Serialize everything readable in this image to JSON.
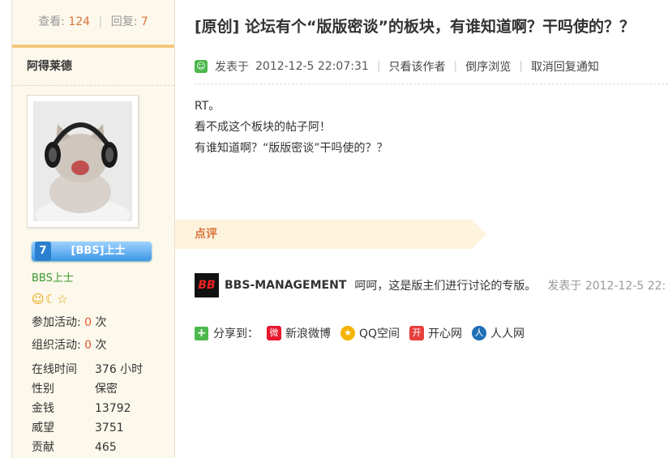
{
  "stats": {
    "views_label": "查看:",
    "views": "124",
    "replies_label": "回复:",
    "replies": "7"
  },
  "author": {
    "name": "阿得莱德",
    "badge_level": "7",
    "badge_title": "[BBS]上士",
    "group": "BBS上士",
    "activity_join_label": "参加活动:",
    "activity_join": "0",
    "activity_org_label": "组织活动:",
    "activity_org": "0",
    "times_unit": "次",
    "info": [
      {
        "k": "在线时间",
        "v": "376 小时"
      },
      {
        "k": "性别",
        "v": "保密"
      },
      {
        "k": "金钱",
        "v": "13792"
      },
      {
        "k": "威望",
        "v": "3751"
      },
      {
        "k": "贡献",
        "v": "465"
      }
    ]
  },
  "post": {
    "title": "[原创] 论坛有个“版版密谈”的板块，有谁知道啊？干吗使的？？",
    "posted_label": "发表于",
    "posted_time": "2012-12-5 22:07:31",
    "links": [
      "只看该作者",
      "倒序浏览",
      "取消回复通知"
    ],
    "lines": [
      "RT。",
      "看不成这个板块的帖子阿！",
      "有谁知道啊？“版版密谈”干吗使的？？"
    ]
  },
  "comments": {
    "tab_label": "点评",
    "author": "BBS-MANAGEMENT",
    "text": "呵呵，这是版主们进行讨论的专版。",
    "time": "发表于  2012-12-5 22:"
  },
  "share": {
    "label": "分享到：",
    "items": [
      {
        "label": "新浪微博",
        "icon": "weibo-icon",
        "color": "#e6162d"
      },
      {
        "label": "QQ空间",
        "icon": "qzone-icon",
        "color": "#f5b400"
      },
      {
        "label": "开心网",
        "icon": "kaixin-icon",
        "color": "#e7403c"
      },
      {
        "label": "人人网",
        "icon": "renren-icon",
        "color": "#1f6fb6"
      }
    ]
  }
}
